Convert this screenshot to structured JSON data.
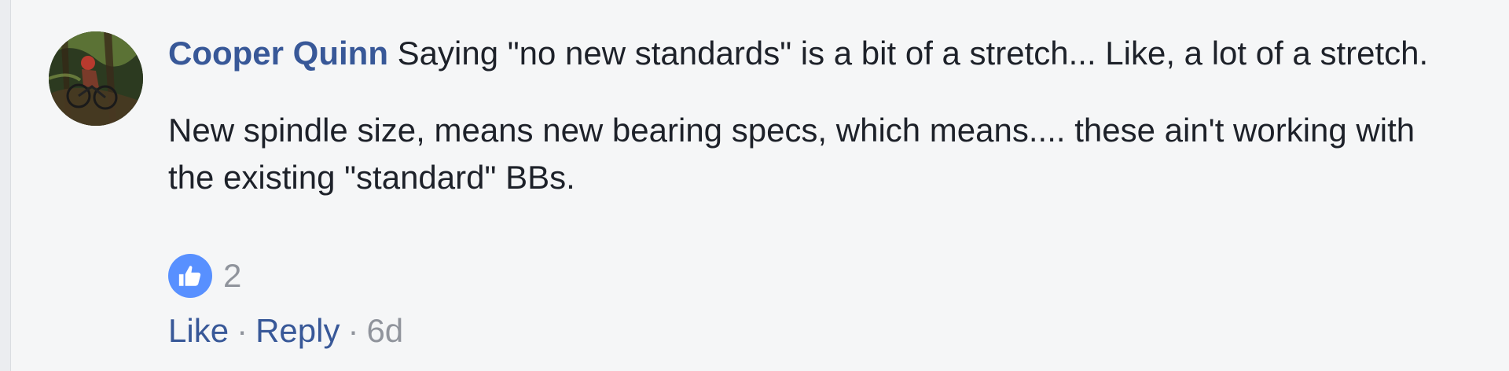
{
  "comment": {
    "author": "Cooper Quinn",
    "paragraphs": [
      "Saying \"no new standards\" is a bit of a stretch... Like, a lot of a stretch.",
      "New spindle size, means new bearing specs, which means.... these ain't working with the existing \"standard\" BBs."
    ],
    "reaction": {
      "icon": "thumbs-up-icon",
      "count": "2",
      "color": "#5890ff"
    },
    "actions": {
      "like_label": "Like",
      "separator": "·",
      "reply_label": "Reply",
      "timestamp": "6d"
    }
  },
  "colors": {
    "author_link": "#385898",
    "body_text": "#1d2129",
    "meta_text": "#90949c",
    "background": "#f5f6f7"
  }
}
